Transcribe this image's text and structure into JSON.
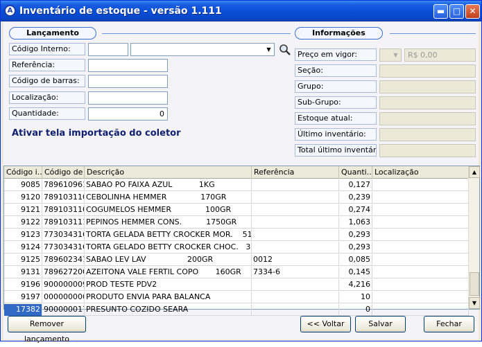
{
  "window": {
    "title": "Inventário de estoque - versão 1.111",
    "icon_letter": "A"
  },
  "lancamento": {
    "header": "Lançamento",
    "codigo_interno_label": "Código Interno:",
    "referencia_label": "Referência:",
    "codigo_barras_label": "Código de barras:",
    "localizacao_label": "Localização:",
    "quantidade_label": "Quantidade:",
    "quantidade_value": "0",
    "import_link": "Ativar tela importação do coletor"
  },
  "informacoes": {
    "header": "Informações",
    "preco_label": "Preço em vigor:",
    "preco_value": "R$ 0,00",
    "secao_label": "Seção:",
    "grupo_label": "Grupo:",
    "subgrupo_label": "Sub-Grupo:",
    "estoque_label": "Estoque atual:",
    "ultimo_inv_label": "Último inventário:",
    "total_inv_label": "Total último inventário:"
  },
  "grid": {
    "columns": [
      "Código i...",
      "Código de ...",
      "Descrição",
      "Referência",
      "Quanti...",
      "Localização"
    ],
    "rows": [
      [
        "9085",
        "7896109610",
        "SABAO PO FAIXA AZUL           1KG",
        "",
        "0,127",
        ""
      ],
      [
        "9120",
        "7891031102",
        "CEBOLINHA HEMMER              170GR",
        "",
        "0,239",
        ""
      ],
      [
        "9121",
        "7891031105",
        "COGUMELOS HEMMER              100GR",
        "",
        "0,274",
        ""
      ],
      [
        "9122",
        "7891031112",
        "PEPINOS HEMMER CONS.          1750GR",
        "",
        "1,063",
        ""
      ],
      [
        "9123",
        "7730343163",
        "TORTA GELADA BETTY CROCKER MOR.    515",
        "",
        "0,293",
        ""
      ],
      [
        "9124",
        "7730343161",
        "TORTA GELADO BETTY CROCKER CHOC.   355",
        "",
        "0,293",
        ""
      ],
      [
        "9125",
        "7896023410",
        "SABAO LEV LAV                 200GR",
        "0012",
        "0,085",
        ""
      ],
      [
        "9131",
        "7896272000",
        "AZEITONA VALE FERTIL COPO       160GR",
        "7334-6",
        "0,145",
        ""
      ],
      [
        "9196",
        "9000000091",
        "PROD TESTE PDV2",
        "",
        "4,216",
        ""
      ],
      [
        "9197",
        "0000000000",
        "PRODUTO ENVIA PARA BALANCA",
        "",
        "10",
        ""
      ],
      [
        "17382",
        "9000000173",
        "PRESUNTO COZIDO SEARA",
        "",
        "0",
        ""
      ]
    ],
    "selected_row": 10
  },
  "buttons": {
    "remover": "Remover lançamento",
    "voltar": "<< Voltar",
    "salvar": "Salvar",
    "fechar": "Fechar"
  }
}
